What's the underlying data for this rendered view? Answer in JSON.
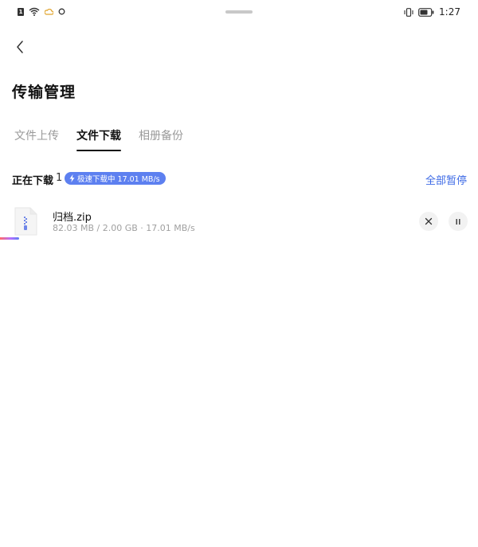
{
  "status_bar": {
    "sim_label": "1",
    "time": "1:27"
  },
  "header": {
    "title": "传输管理"
  },
  "tabs": [
    {
      "label": "文件上传",
      "active": false
    },
    {
      "label": "文件下载",
      "active": true
    },
    {
      "label": "相册备份",
      "active": false
    }
  ],
  "section": {
    "title": "正在下载",
    "count": "1",
    "speed_badge": "极速下载中 17.01 MB/s",
    "pause_all_label": "全部暂停"
  },
  "downloads": [
    {
      "name": "归档.zip",
      "meta": "82.03 MB / 2.00 GB · 17.01 MB/s",
      "progress": 0.04
    }
  ],
  "colors": {
    "accent": "#3d6ae6",
    "badge": "#5d80f0",
    "muted": "#a0a0a0"
  }
}
